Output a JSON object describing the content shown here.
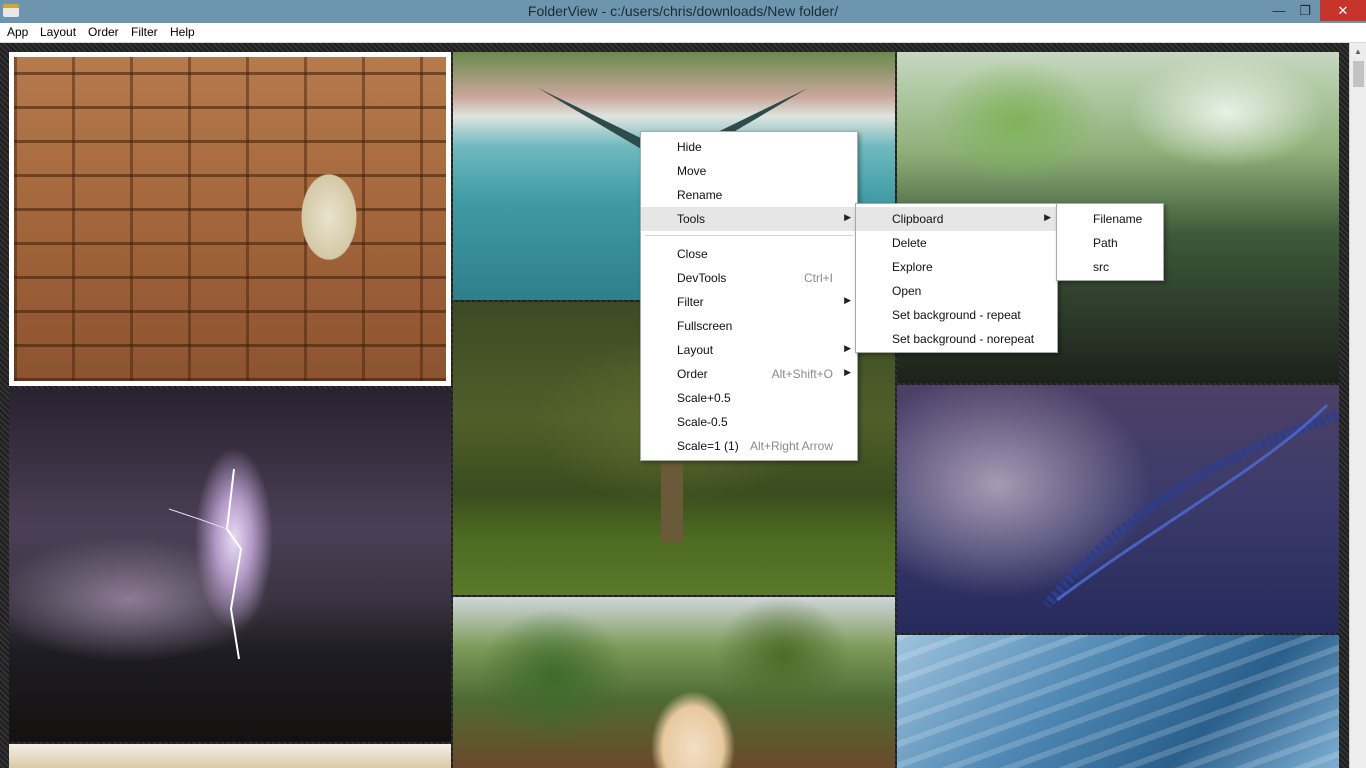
{
  "window": {
    "title": "FolderView - c:/users/chris/downloads/New folder/",
    "minimize_glyph": "—",
    "maximize_glyph": "❐",
    "close_glyph": "✕"
  },
  "menubar": [
    "App",
    "Layout",
    "Order",
    "Filter",
    "Help"
  ],
  "image_tiles": [
    {
      "subject": "stone wall window"
    },
    {
      "subject": "dragonfly over water"
    },
    {
      "subject": "aquarium plants"
    },
    {
      "subject": "lightning storm"
    },
    {
      "subject": "mossy tree"
    },
    {
      "subject": "blue fern frond"
    },
    {
      "subject": "garden portrait"
    },
    {
      "subject": "blue marble cave"
    },
    {
      "subject": "partial image"
    }
  ],
  "context_menu": {
    "items": [
      {
        "label": "Hide",
        "accel": "",
        "submenu": false
      },
      {
        "label": "Move",
        "accel": "",
        "submenu": false
      },
      {
        "label": "Rename",
        "accel": "",
        "submenu": false
      },
      {
        "label": "Tools",
        "accel": "",
        "submenu": true
      },
      {
        "label": "Close",
        "accel": "",
        "submenu": false
      },
      {
        "label": "DevTools",
        "accel": "Ctrl+I",
        "submenu": false
      },
      {
        "label": "Filter",
        "accel": "",
        "submenu": true
      },
      {
        "label": "Fullscreen",
        "accel": "",
        "submenu": false
      },
      {
        "label": "Layout",
        "accel": "",
        "submenu": true
      },
      {
        "label": "Order",
        "accel": "Alt+Shift+O",
        "submenu": true
      },
      {
        "label": "Scale+0.5",
        "accel": "",
        "submenu": false
      },
      {
        "label": "Scale-0.5",
        "accel": "",
        "submenu": false
      },
      {
        "label": "Scale=1 (1)",
        "accel": "Alt+Right Arrow",
        "submenu": false
      }
    ],
    "highlighted": "Tools"
  },
  "tools_submenu": {
    "items": [
      {
        "label": "Clipboard",
        "submenu": true
      },
      {
        "label": "Delete",
        "submenu": false
      },
      {
        "label": "Explore",
        "submenu": false
      },
      {
        "label": "Open",
        "submenu": false
      },
      {
        "label": "Set background - repeat",
        "submenu": false
      },
      {
        "label": "Set background - norepeat",
        "submenu": false
      }
    ],
    "highlighted": "Clipboard"
  },
  "clipboard_submenu": {
    "items": [
      "Filename",
      "Path",
      "src"
    ]
  },
  "submenu_arrow": "▶",
  "scroll_up_glyph": "▲",
  "colors": {
    "titlebar": "#6d95ad",
    "close_button": "#c7342c",
    "menu_highlight": "#e6e6e6"
  }
}
